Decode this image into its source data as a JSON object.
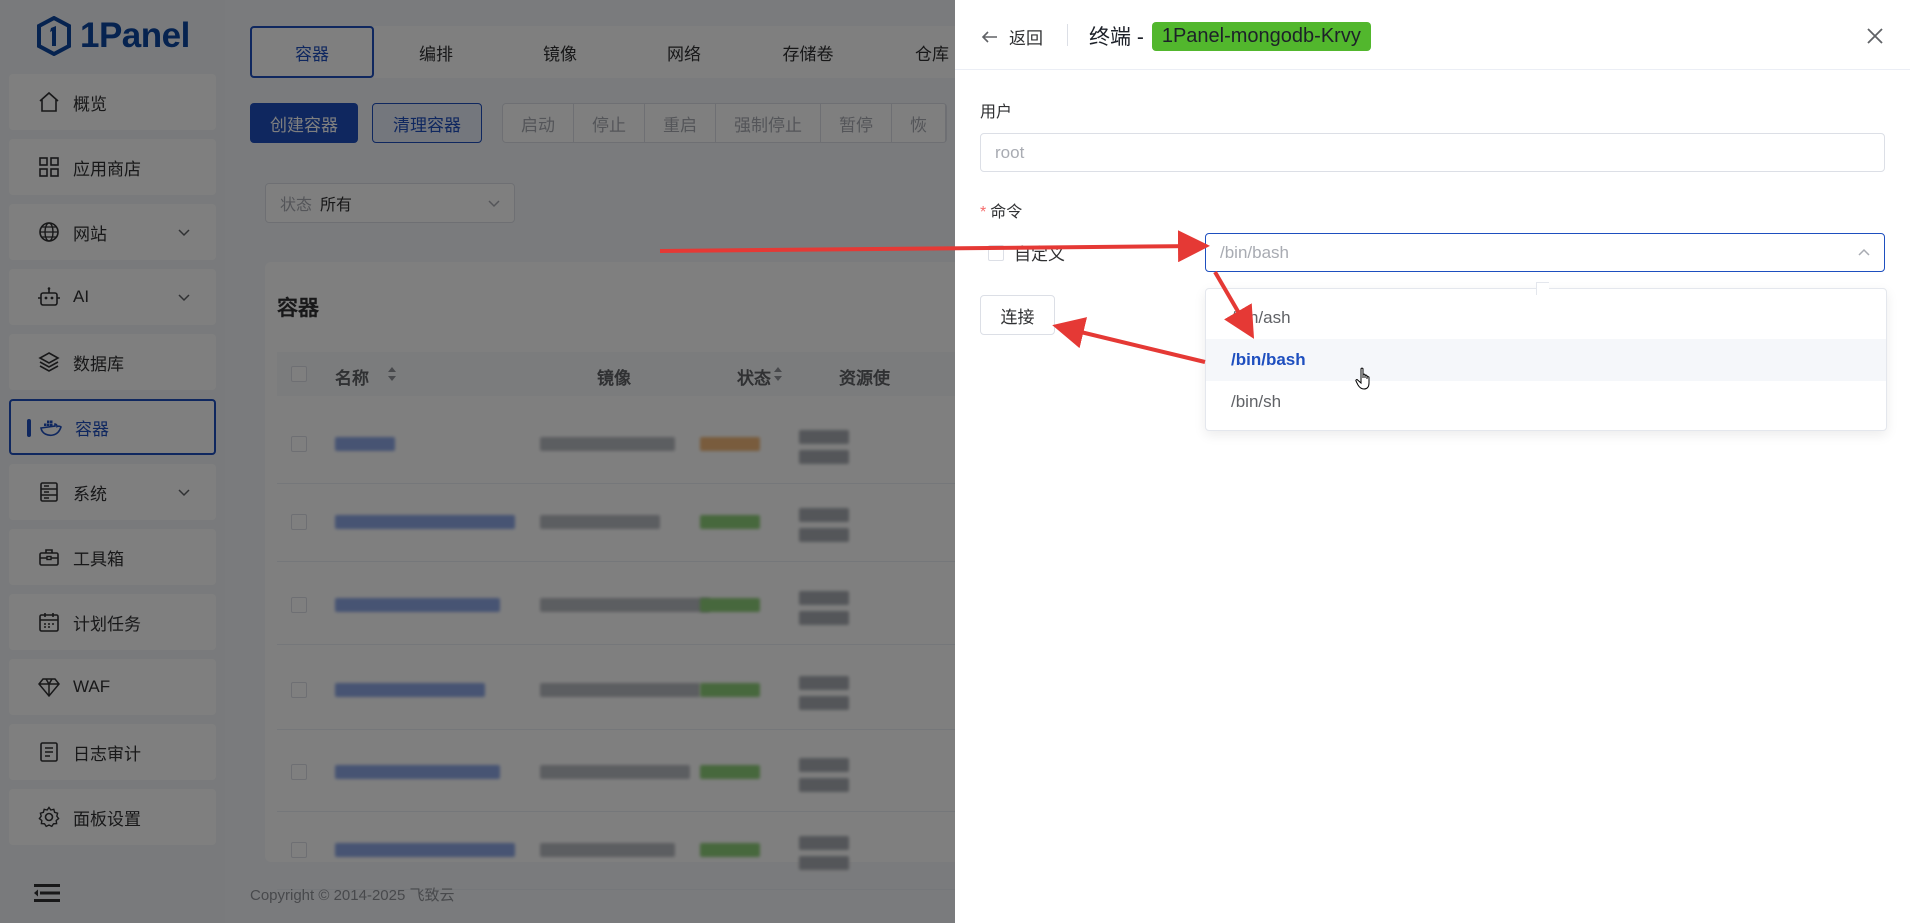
{
  "app": {
    "logo_text": "1Panel"
  },
  "sidebar": {
    "items": [
      {
        "label": "概览",
        "icon": "home-icon",
        "expandable": false
      },
      {
        "label": "应用商店",
        "icon": "grid-icon",
        "expandable": false
      },
      {
        "label": "网站",
        "icon": "globe-icon",
        "expandable": true
      },
      {
        "label": "AI",
        "icon": "robot-icon",
        "expandable": true
      },
      {
        "label": "数据库",
        "icon": "layers-icon",
        "expandable": false
      },
      {
        "label": "容器",
        "icon": "docker-icon",
        "expandable": false,
        "active": true
      },
      {
        "label": "系统",
        "icon": "server-icon",
        "expandable": true
      },
      {
        "label": "工具箱",
        "icon": "toolbox-icon",
        "expandable": false
      },
      {
        "label": "计划任务",
        "icon": "calendar-icon",
        "expandable": false
      },
      {
        "label": "WAF",
        "icon": "diamond-icon",
        "expandable": false
      },
      {
        "label": "日志审计",
        "icon": "log-icon",
        "expandable": false
      },
      {
        "label": "面板设置",
        "icon": "gear-icon",
        "expandable": false
      }
    ]
  },
  "main": {
    "tabs": [
      "容器",
      "编排",
      "镜像",
      "网络",
      "存储卷",
      "仓库"
    ],
    "toolbar": {
      "create": "创建容器",
      "clean": "清理容器",
      "group": [
        "启动",
        "停止",
        "重启",
        "强制停止",
        "暂停",
        "恢"
      ]
    },
    "filter": {
      "label": "状态",
      "value": "所有"
    },
    "card_title": "容器",
    "table_headers": [
      "名称",
      "镜像",
      "状态",
      "资源使"
    ],
    "footer": "Copyright © 2014-2025 飞致云"
  },
  "drawer": {
    "back_label": "返回",
    "title_prefix": "终端 -",
    "container_name": "1Panel-mongodb-Krvy",
    "user_label": "用户",
    "user_placeholder": "root",
    "command_label": "命令",
    "custom_label": "自定义",
    "command_value": "/bin/bash",
    "options": [
      "/bin/ash",
      "/bin/bash",
      "/bin/sh"
    ],
    "selected_option": "/bin/bash",
    "connect_label": "连接"
  },
  "colors": {
    "accent": "#1e4fbf",
    "tag": "#52b72d",
    "annotation": "#e53935"
  }
}
